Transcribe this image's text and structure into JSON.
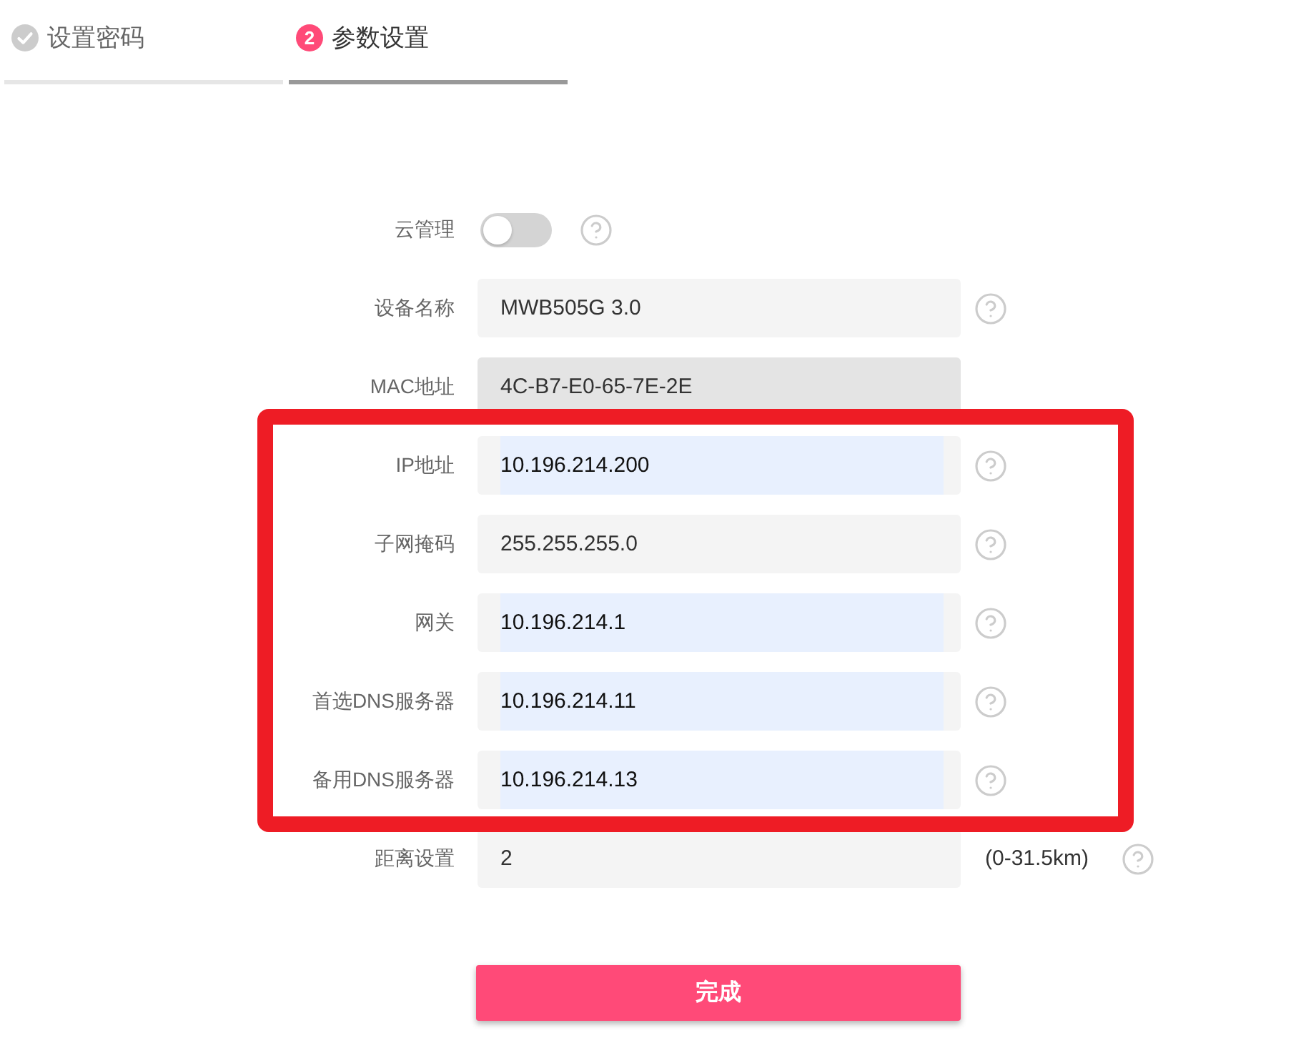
{
  "tabs": [
    {
      "label": "设置密码",
      "selected": false,
      "done": true
    },
    {
      "label": "参数设置",
      "selected": true,
      "done": false,
      "number": "2"
    }
  ],
  "fields": [
    {
      "kind": "toggle",
      "label": "云管理",
      "on": false,
      "help": true,
      "highlighted": false
    },
    {
      "kind": "input",
      "label": "设备名称",
      "value": "MWB505G 3.0",
      "autofilled": false,
      "help": true,
      "highlighted": false
    },
    {
      "kind": "readonly",
      "label": "MAC地址",
      "value": "4C-B7-E0-65-7E-2E",
      "autofilled": false,
      "help": false,
      "highlighted": false
    },
    {
      "kind": "input",
      "label": "IP地址",
      "value": "10.196.214.200",
      "autofilled": true,
      "help": true,
      "highlighted": true
    },
    {
      "kind": "input",
      "label": "子网掩码",
      "value": "255.255.255.0",
      "autofilled": false,
      "help": true,
      "highlighted": true
    },
    {
      "kind": "input",
      "label": "网关",
      "value": "10.196.214.1",
      "autofilled": true,
      "help": true,
      "highlighted": true
    },
    {
      "kind": "input",
      "label": "首选DNS服务器",
      "value": "10.196.214.11",
      "autofilled": true,
      "help": true,
      "highlighted": true
    },
    {
      "kind": "input",
      "label": "备用DNS服务器",
      "value": "10.196.214.13",
      "autofilled": true,
      "help": true,
      "highlighted": true
    },
    {
      "kind": "input",
      "label": "距离设置",
      "value": "2",
      "autofilled": false,
      "help": true,
      "highlighted": false,
      "suffix": "(0-31.5km)"
    }
  ],
  "submit_button": {
    "label": "完成"
  }
}
